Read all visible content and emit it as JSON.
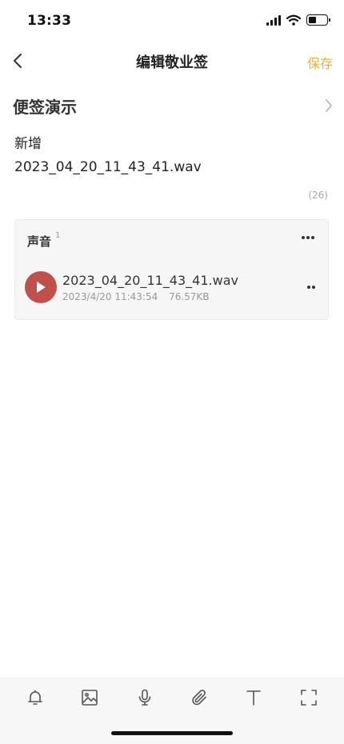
{
  "status_bar": {
    "time": "13:33",
    "battery_level": 0.45
  },
  "nav": {
    "title": "编辑敬业签",
    "save_label": "保存"
  },
  "note": {
    "title": "便签演示",
    "body_lines": [
      "新增",
      "2023_04_20_11_43_41.wav"
    ],
    "char_count": "(26)"
  },
  "audio_section": {
    "label": "声音",
    "count": "1",
    "items": [
      {
        "filename": "2023_04_20_11_43_41.wav",
        "datetime": "2023/4/20 11:43:54",
        "size": "76.57KB"
      }
    ]
  },
  "toolbar": {
    "icons": [
      "bell-icon",
      "image-icon",
      "microphone-icon",
      "paperclip-icon",
      "text-icon",
      "fullscreen-icon"
    ]
  },
  "colors": {
    "accent": "#f0b03c",
    "play_button": "#c0504a",
    "card_background": "#f6f6f6"
  }
}
